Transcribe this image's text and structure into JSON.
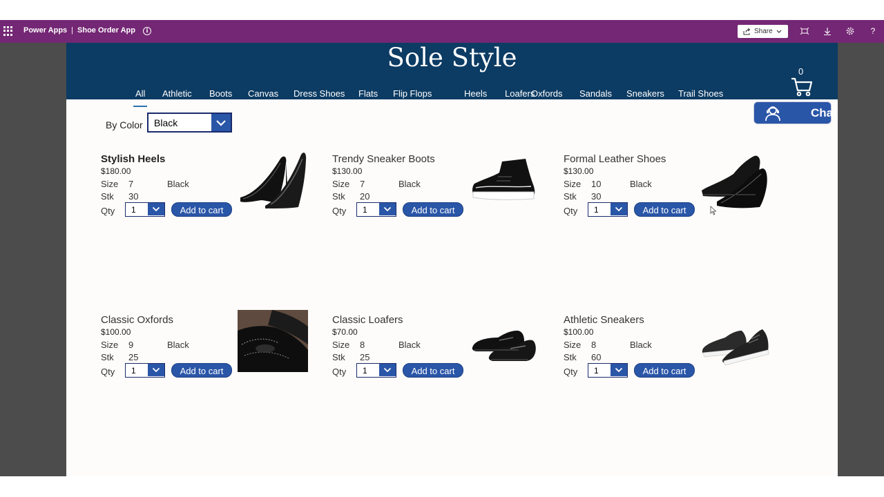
{
  "topbar": {
    "app_name": "Power Apps",
    "separator": "|",
    "app_title": "Shoe Order App",
    "share_label": "Share"
  },
  "header": {
    "brand": "Sole Style",
    "cart_count": "0",
    "chat_label": "Chat"
  },
  "categories": [
    "All",
    "Athletic",
    "Boots",
    "Canvas",
    "Dress Shoes",
    "Flats",
    "Flip Flops",
    "Heels",
    "Loafers",
    "Oxfords",
    "Sandals",
    "Sneakers",
    "Trail Shoes"
  ],
  "filter": {
    "label": "By Color",
    "value": "Black"
  },
  "labels": {
    "size": "Size",
    "stk": "Stk",
    "qty": "Qty",
    "add_to_cart": "Add to cart"
  },
  "products": [
    {
      "name": "Stylish Heels",
      "price": "$180.00",
      "size": "7",
      "color": "Black",
      "stock": "30",
      "qty": "1",
      "icon": "heels-shoe-icon"
    },
    {
      "name": "Trendy Sneaker Boots",
      "price": "$130.00",
      "size": "7",
      "color": "Black",
      "stock": "20",
      "qty": "1",
      "icon": "sneaker-boot-icon"
    },
    {
      "name": "Formal Leather Shoes",
      "price": "$130.00",
      "size": "10",
      "color": "Black",
      "stock": "30",
      "qty": "1",
      "icon": "leather-shoe-icon"
    },
    {
      "name": "Classic Oxfords",
      "price": "$100.00",
      "size": "9",
      "color": "Black",
      "stock": "25",
      "qty": "1",
      "icon": "oxford-shoe-icon"
    },
    {
      "name": "Classic Loafers",
      "price": "$70.00",
      "size": "8",
      "color": "Black",
      "stock": "25",
      "qty": "1",
      "icon": "loafer-shoe-icon"
    },
    {
      "name": "Athletic Sneakers",
      "price": "$100.00",
      "size": "8",
      "color": "Black",
      "stock": "60",
      "qty": "1",
      "icon": "athletic-sneaker-icon"
    }
  ],
  "colors": {
    "topbar": "#742774",
    "header": "#0c3b63",
    "accent": "#2a56a8"
  }
}
